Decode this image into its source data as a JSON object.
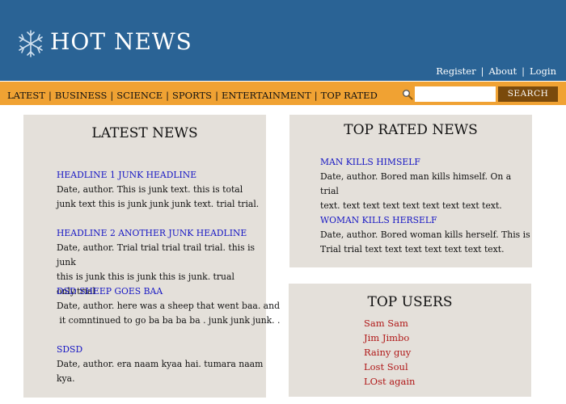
{
  "header": {
    "title": "HOT NEWS",
    "logo_icon": "snowflake-icon",
    "links": [
      "Register",
      "About",
      "Login"
    ]
  },
  "nav": {
    "items": [
      "LATEST",
      "BUSINESS",
      "SCIENCE",
      "SPORTS",
      "ENTERTAINMENT",
      "TOP RATED"
    ]
  },
  "search": {
    "icon": "magnifier-icon",
    "value": "",
    "button_label": "SEARCH"
  },
  "latest": {
    "title": "LATEST NEWS",
    "items": [
      {
        "headline": "HEADLINE 1 JUNK HEADLINE",
        "line1": "Date, author. This is junk text. this is total",
        "line2": "junk text this is junk junk junk text. trial trial."
      },
      {
        "headline": "HEADLINE 2 ANOTHER JUNK HEADLINE",
        "line1": "Date, author. Trial trial trial trail trial. this is junk",
        "line2": "this is junk this is junk this is junk. trual only.trial"
      },
      {
        "headline": "DSD SHEEP GOES BAA",
        "line1": "Date, author. here was a sheep that went baa. and",
        "line2": " it comntinued to go ba ba ba ba . junk junk junk. ."
      },
      {
        "headline": "SDSD",
        "line1": "Date, author. era naam kyaa hai. tumara naam kya.",
        "line2": ""
      }
    ]
  },
  "top_rated": {
    "title": "TOP RATED NEWS",
    "items": [
      {
        "headline": "MAN KILLS HIMSELF",
        "line1": "Date, author. Bored man kills himself. On a trial",
        "line2": "text. text text text text text text text text."
      },
      {
        "headline": "WOMAN KILLS HERSELF",
        "line1": "Date, author. Bored woman kills herself. This is",
        "line2": "Trial trial text text text text text text text."
      }
    ]
  },
  "top_users": {
    "title": "TOP USERS",
    "users": [
      "Sam Sam",
      "Jim Jimbo",
      "Rainy guy",
      "Lost Soul",
      "LOst again"
    ]
  },
  "colors": {
    "header_bg": "#2a6395",
    "nav_bg": "#f0a233",
    "panel_bg": "#e4e0da",
    "headline": "#1616c4",
    "user_link": "#b01818",
    "search_button": "#7a4a0c"
  }
}
